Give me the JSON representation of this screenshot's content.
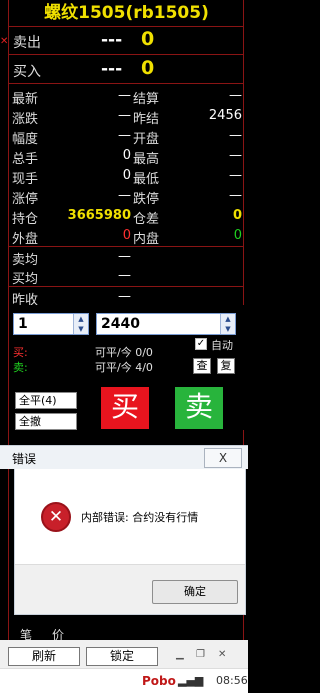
{
  "contract_title": "螺纹1505(rb1505)",
  "quotes": {
    "sell": {
      "label": "卖出",
      "dash": "---",
      "value": "0"
    },
    "buy": {
      "label": "买入",
      "dash": "---",
      "value": "0"
    }
  },
  "fields": [
    {
      "l1": "最新",
      "v1": "—",
      "l2": "结算",
      "v2": "—"
    },
    {
      "l1": "涨跌",
      "v1": "—",
      "l2": "昨结",
      "v2": "2456"
    },
    {
      "l1": "幅度",
      "v1": "—",
      "l2": "开盘",
      "v2": "—"
    },
    {
      "l1": "总手",
      "v1": "0",
      "l2": "最高",
      "v2": "—"
    },
    {
      "l1": "现手",
      "v1": "0",
      "l2": "最低",
      "v2": "—"
    },
    {
      "l1": "涨停",
      "v1": "—",
      "l2": "跌停",
      "v2": "—"
    },
    {
      "l1": "持仓",
      "v1": "3665980",
      "l2": "仓差",
      "v2": "0"
    },
    {
      "l1": "外盘",
      "v1": "0",
      "l2": "内盘",
      "v2": "0"
    }
  ],
  "averages": [
    {
      "label": "卖均",
      "value": "—"
    },
    {
      "label": "买均",
      "value": "—"
    },
    {
      "label": "昨收",
      "value": "—"
    }
  ],
  "order": {
    "qty": "1",
    "price": "2440",
    "auto_label": "自动",
    "auto_checked": true,
    "buy_label": "买:",
    "sell_label": "卖:",
    "buy_avail": "可平/今 0/0",
    "sell_avail": "可平/今 4/0",
    "query_btn": "查",
    "repeat_btn": "复",
    "close_all": "全平(4)",
    "cancel_all": "全撤",
    "buy_btn": "买",
    "sell_btn": "卖",
    "colors": {
      "buy": "#e8141e",
      "sell": "#28b43c"
    }
  },
  "dialog": {
    "title": "错误",
    "close_symbol": "X",
    "message": "内部错误: 合约没有行情",
    "ok": "确定"
  },
  "footer_tabs": [
    "笔",
    "价"
  ],
  "bottom": {
    "refresh": "刷新",
    "lock": "锁定"
  },
  "taskbar": {
    "brand": "Pobo",
    "clock": "08:56"
  }
}
